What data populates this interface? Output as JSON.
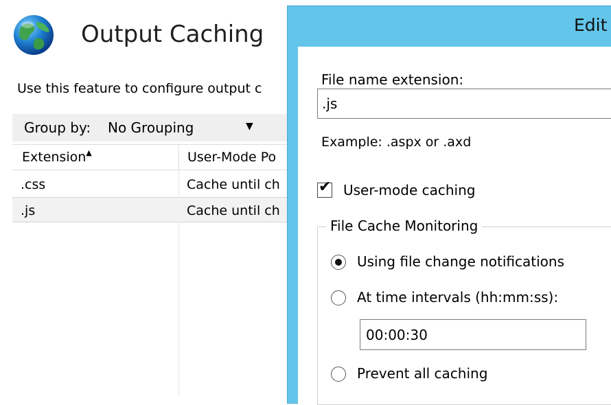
{
  "feature_page": {
    "title": "Output Caching",
    "description": "Use this feature to configure output c",
    "group_by_label": "Group by:",
    "group_by_value": "No Grouping",
    "columns": [
      "Extension",
      "User-Mode Po"
    ],
    "rows": [
      {
        "extension": ".css",
        "user_mode": "Cache until ch"
      },
      {
        "extension": ".js",
        "user_mode": "Cache until ch"
      }
    ],
    "selected_row": 1
  },
  "dialog": {
    "title": "Edit",
    "file_ext_label": "File name extension:",
    "file_ext_value": ".js",
    "example_text": "Example: .aspx or .axd",
    "user_mode_checkbox": {
      "label": "User-mode caching",
      "checked": true
    },
    "group_title": "File Cache Monitoring",
    "radios": [
      {
        "label": "Using file change notifications",
        "checked": true
      },
      {
        "label": "At time intervals (hh:mm:ss):",
        "checked": false
      },
      {
        "label": "Prevent all caching",
        "checked": false
      }
    ],
    "time_interval_value": "00:00:30"
  },
  "colors": {
    "dialog_chrome": "#63c5ea",
    "selected_row_bg": "#f2f2f2"
  },
  "icons": {
    "feature_icon": "globe-icon",
    "sort": "sort-ascending-icon",
    "dropdown": "chevron-down-icon",
    "check": "checkmark-icon"
  }
}
